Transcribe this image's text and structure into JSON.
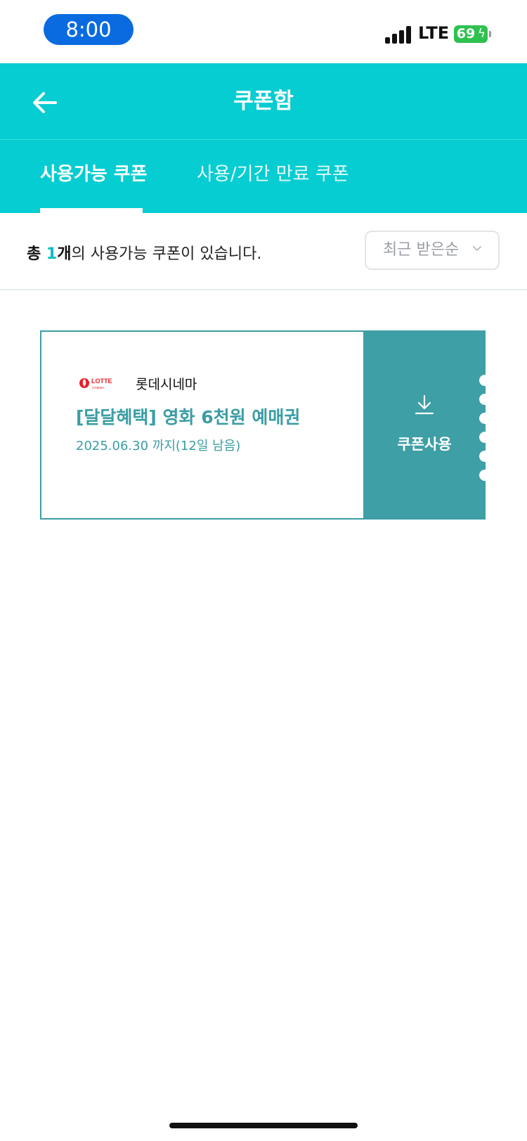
{
  "status_bar": {
    "time": "8:00",
    "network": "LTE",
    "battery": "69"
  },
  "header": {
    "title": "쿠폰함"
  },
  "tabs": [
    {
      "label": "사용가능 쿠폰",
      "active": true
    },
    {
      "label": "사용/기간 만료 쿠폰",
      "active": false
    }
  ],
  "summary": {
    "prefix": "총 ",
    "count": "1",
    "unit": "개",
    "suffix": "의 사용가능 쿠폰이 있습니다."
  },
  "sort": {
    "selected": "최근 받은순"
  },
  "coupon": {
    "brand_logo_text": "LOTTE CINEMA",
    "brand_name": "롯데시네마",
    "title": "[달달혜택] 영화 6천원 예매권",
    "expiry": "2025.06.30 까지(12일 남음)",
    "action_label": "쿠폰사용"
  },
  "colors": {
    "header": "#05cdd2",
    "coupon_accent": "#3a9da5",
    "status_pill": "#0a6be0",
    "battery": "#2fc14f"
  }
}
